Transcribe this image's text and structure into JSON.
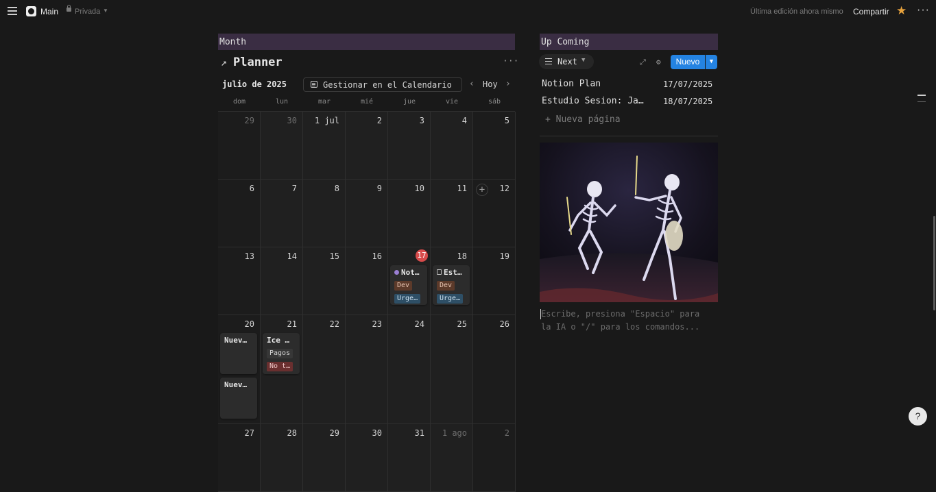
{
  "topbar": {
    "page_title": "Main",
    "privacy": "Privada",
    "last_edited": "Última edición ahora mismo",
    "share_label": "Compartir",
    "more_glyph": "···",
    "star_color": "#e8a33d"
  },
  "planner": {
    "header": "Month",
    "title": "Planner",
    "month_label": "julio de 2025",
    "manage_label": "Gestionar en el Calendario",
    "today_label": "Hoy",
    "weekdays": [
      "dom",
      "lun",
      "mar",
      "mié",
      "jue",
      "vie",
      "sáb"
    ],
    "weeks": [
      [
        "29",
        "30",
        "1 jul",
        "2",
        "3",
        "4",
        "5"
      ],
      [
        "6",
        "7",
        "8",
        "9",
        "10",
        "11",
        "12"
      ],
      [
        "13",
        "14",
        "15",
        "16",
        "17",
        "18",
        "19"
      ],
      [
        "20",
        "21",
        "22",
        "23",
        "24",
        "25",
        "26"
      ],
      [
        "27",
        "28",
        "29",
        "30",
        "31",
        "1 ago",
        "2"
      ]
    ],
    "today_day": "17",
    "events": {
      "e17": {
        "title": "Not…",
        "tag1": "Dev",
        "tag2": "Urge…"
      },
      "e18": {
        "title": "Est…",
        "tag1": "Dev",
        "tag2": "Urge…"
      },
      "e20a": {
        "title": "Nuev…"
      },
      "e20b": {
        "title": "Nuev…"
      },
      "e21": {
        "title": "Ice …",
        "tag1": "Pagos",
        "tag2": "No t…"
      }
    },
    "add_glyph": "+"
  },
  "upcoming": {
    "header": "Up Coming",
    "view_label": "Next",
    "new_label": "Nuevo",
    "rows": [
      {
        "name": "Notion Plan",
        "date": "17/07/2025"
      },
      {
        "name": "Estudio Sesion: Ja…",
        "date": "18/07/2025"
      }
    ],
    "new_page_label": "+ Nueva página",
    "editor_placeholder": "Escribe, presiona \"Espacio\" para la IA o \"/\" para los comandos..."
  },
  "help_glyph": "?",
  "colors": {
    "accent": "#2483e2",
    "today": "#d84b4b",
    "header_bg": "#3a2d43"
  }
}
